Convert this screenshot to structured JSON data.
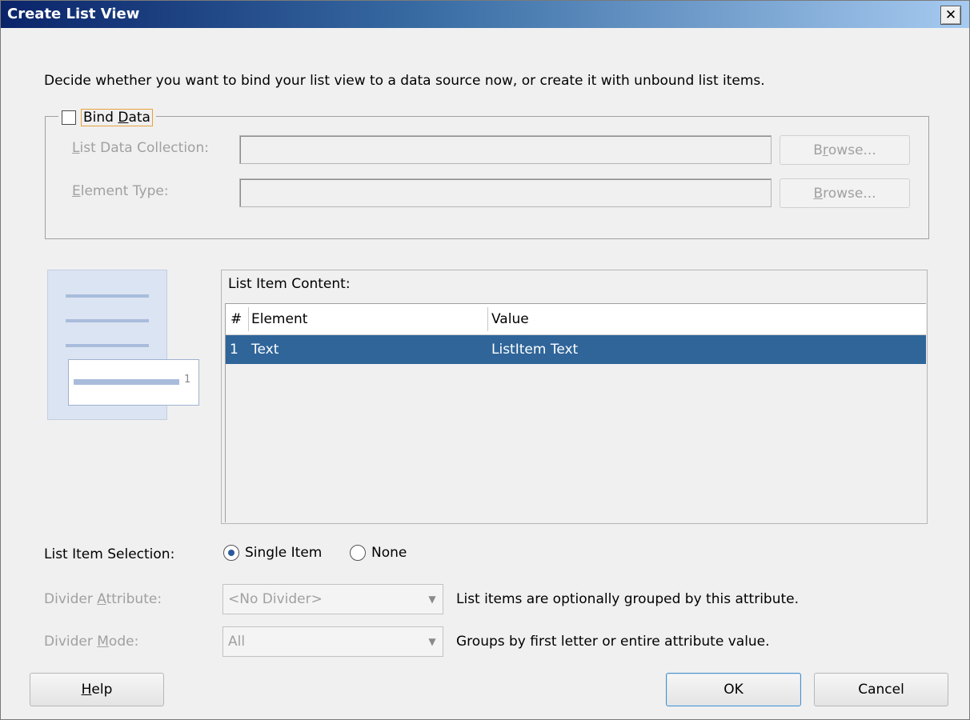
{
  "window": {
    "title": "Create List View",
    "close_label": "✕"
  },
  "description": "Decide whether you want to bind your list view to a data source now, or create it with unbound list items.",
  "bind_data": {
    "label_pre": "Bind ",
    "label_mnemonic": "D",
    "label_post": "ata",
    "checked": false,
    "list_data_collection": {
      "label_mnemonic": "L",
      "label_rest": "ist Data Collection:",
      "value": "",
      "browse_pre": "B",
      "browse_mnemonic": "r",
      "browse_post": "owse..."
    },
    "element_type": {
      "label_mnemonic": "E",
      "label_rest": "lement Type:",
      "value": "",
      "browse_mnemonic": "B",
      "browse_post": "rowse..."
    }
  },
  "preview": {
    "card_number": "1"
  },
  "list_item_content": {
    "heading": "List Item Content:",
    "columns": [
      "#",
      "Element",
      "Value"
    ],
    "rows": [
      {
        "num": "1",
        "element": "Text",
        "value": "ListItem Text",
        "selected": true
      }
    ]
  },
  "list_item_selection": {
    "label": "List Item Selection:",
    "options": [
      {
        "label": "Single Item",
        "selected": true
      },
      {
        "label": "None",
        "selected": false
      }
    ]
  },
  "divider_attribute": {
    "label_pre": "Divider ",
    "label_mnemonic": "A",
    "label_post": "ttribute:",
    "value": "<No Divider>",
    "help": "List items are optionally grouped by this attribute."
  },
  "divider_mode": {
    "label_pre": "Divider ",
    "label_mnemonic": "M",
    "label_post": "ode:",
    "value": "All",
    "help": "Groups by first letter or entire attribute value."
  },
  "buttons": {
    "help_mnemonic": "H",
    "help_rest": "elp",
    "ok": "OK",
    "cancel": "Cancel"
  },
  "colors": {
    "title_gradient_start": "#0a246a",
    "title_gradient_end": "#a6caf0",
    "selection": "#2f6599",
    "focus_outline": "#e8a13c"
  }
}
